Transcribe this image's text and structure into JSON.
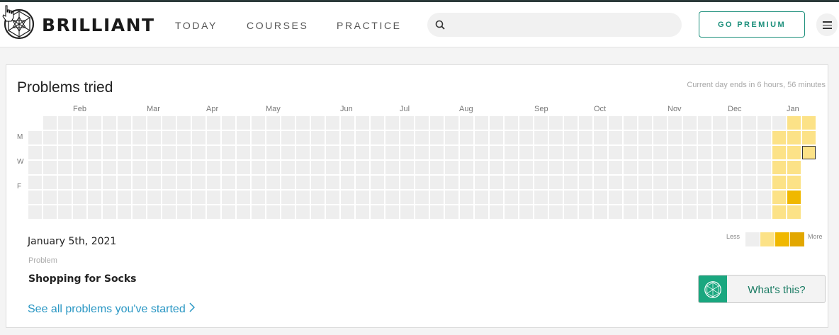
{
  "brand": {
    "name": "BRILLIANT"
  },
  "nav": {
    "links": [
      "TODAY",
      "COURSES",
      "PRACTICE"
    ],
    "search_placeholder": "",
    "premium_label": "GO PREMIUM"
  },
  "heatmap": {
    "title": "Problems tried",
    "note": "Current day ends in 6 hours, 56 minutes",
    "months": [
      "Feb",
      "Mar",
      "Apr",
      "May",
      "Jun",
      "Jul",
      "Aug",
      "Sep",
      "Oct",
      "Nov",
      "Dec",
      "Jan"
    ],
    "day_labels": [
      "M",
      "W",
      "F"
    ],
    "weeks": 53,
    "levels": [
      [
        0,
        0,
        0,
        0,
        0,
        0,
        0,
        0,
        0,
        0,
        0,
        0,
        0,
        0,
        0,
        0,
        0,
        0,
        0,
        0,
        0,
        0,
        0,
        0,
        0,
        0,
        0,
        0,
        0,
        0,
        0,
        0,
        0,
        0,
        0,
        0,
        0,
        0,
        0,
        0,
        0,
        0,
        0,
        0,
        0,
        0,
        0,
        0,
        0,
        0,
        0,
        0,
        0
      ],
      [
        0,
        0,
        0,
        0,
        0,
        0,
        0,
        0,
        0,
        0,
        0,
        0,
        0,
        0,
        0,
        0,
        0,
        0,
        0,
        0,
        0,
        0,
        0,
        0,
        0,
        0,
        0,
        0,
        0,
        0,
        0,
        0,
        0,
        0,
        0,
        0,
        0,
        0,
        0,
        0,
        0,
        0,
        0,
        0,
        0,
        0,
        0,
        0,
        0,
        0,
        0,
        0,
        0
      ],
      [
        0,
        0,
        0,
        0,
        0,
        0,
        0,
        0,
        0,
        0,
        0,
        0,
        0,
        0,
        0,
        0,
        0,
        0,
        0,
        0,
        0,
        0,
        0,
        0,
        0,
        0,
        0,
        0,
        0,
        0,
        0,
        0,
        0,
        0,
        0,
        0,
        0,
        0,
        0,
        0,
        0,
        0,
        0,
        0,
        0,
        0,
        0,
        0,
        0,
        0,
        0,
        0,
        0
      ],
      [
        0,
        0,
        0,
        0,
        0,
        0,
        0,
        0,
        0,
        0,
        0,
        0,
        0,
        0,
        0,
        0,
        0,
        0,
        0,
        0,
        0,
        0,
        0,
        0,
        0,
        0,
        0,
        0,
        0,
        0,
        0,
        0,
        0,
        0,
        0,
        0,
        0,
        0,
        0,
        0,
        0,
        0,
        0,
        0,
        0,
        0,
        0,
        0,
        0,
        0,
        0,
        0,
        0
      ],
      [
        0,
        0,
        0,
        0,
        0,
        0,
        0,
        0,
        0,
        0,
        0,
        0,
        0,
        0,
        0,
        0,
        0,
        0,
        0,
        0,
        0,
        0,
        0,
        0,
        0,
        0,
        0,
        0,
        0,
        0,
        0,
        0,
        0,
        0,
        0,
        0,
        0,
        0,
        0,
        0,
        0,
        0,
        0,
        0,
        0,
        0,
        0,
        0,
        0,
        0,
        0,
        0,
        0
      ],
      [
        0,
        0,
        0,
        0,
        0,
        0,
        0,
        0,
        0,
        0,
        0,
        0,
        0,
        0,
        0,
        0,
        0,
        0,
        0,
        0,
        0,
        0,
        0,
        0,
        0,
        0,
        0,
        0,
        0,
        0,
        0,
        0,
        0,
        0,
        0,
        0,
        0,
        0,
        0,
        0,
        0,
        0,
        0,
        0,
        0,
        0,
        0,
        0,
        0,
        0,
        0,
        0,
        0
      ],
      [
        0,
        0,
        0,
        0,
        0,
        0,
        0,
        0,
        0,
        0,
        0,
        0,
        0,
        0,
        0,
        0,
        0,
        0,
        0,
        0,
        0,
        0,
        0,
        0,
        0,
        0,
        0,
        0,
        0,
        0,
        0,
        0,
        0,
        0,
        0,
        0,
        0,
        0,
        0,
        0,
        0,
        0,
        0,
        0,
        0,
        0,
        0,
        0,
        0,
        0,
        0,
        0,
        0
      ]
    ],
    "active": [
      {
        "week": 51,
        "day": 0,
        "level": 1
      },
      {
        "week": 51,
        "day": 1,
        "level": 1
      },
      {
        "week": 51,
        "day": 2,
        "level": 1
      },
      {
        "week": 51,
        "day": 3,
        "level": 1
      },
      {
        "week": 51,
        "day": 4,
        "level": 1
      },
      {
        "week": 51,
        "day": 5,
        "level": 3
      },
      {
        "week": 51,
        "day": 6,
        "level": 1
      },
      {
        "week": 50,
        "day": 1,
        "level": 1
      },
      {
        "week": 50,
        "day": 2,
        "level": 1
      },
      {
        "week": 50,
        "day": 3,
        "level": 1
      },
      {
        "week": 50,
        "day": 4,
        "level": 1
      },
      {
        "week": 50,
        "day": 5,
        "level": 1
      },
      {
        "week": 50,
        "day": 6,
        "level": 1
      },
      {
        "week": 52,
        "day": 0,
        "level": 1
      },
      {
        "week": 52,
        "day": 1,
        "level": 1
      },
      {
        "week": 52,
        "day": 2,
        "level": 1
      }
    ],
    "first_week_start_day": 1,
    "last_week_end_day": 2,
    "selected": {
      "week": 52,
      "day": 2
    },
    "level_colors": [
      "#eeeeee",
      "#fce287",
      "#f6c53a",
      "#f0b800",
      "#e2a700"
    ],
    "legend": {
      "less": "Less",
      "more": "More",
      "colors": [
        "#eeeeee",
        "#fce287",
        "#f0b800",
        "#e2a700"
      ]
    }
  },
  "selection": {
    "date": "January 5th, 2021",
    "kind": "Problem",
    "name": "Shopping for Socks",
    "see_all": "See all problems you've started"
  },
  "whats_this": {
    "label": "What's this?"
  },
  "colors": {
    "accent": "#1c8f7b",
    "link": "#2a97c4"
  }
}
